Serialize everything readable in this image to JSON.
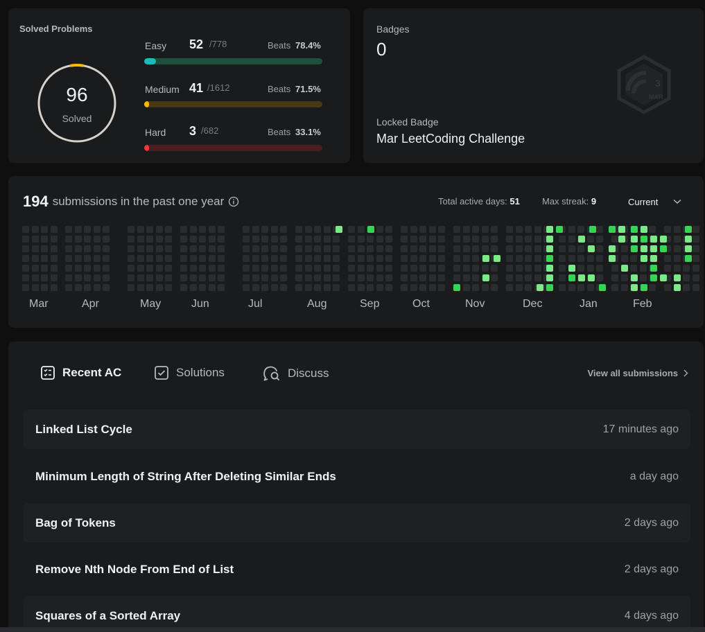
{
  "solved": {
    "title": "Solved Problems",
    "total": "96",
    "total_label": "Solved",
    "easy": {
      "label": "Easy",
      "count": "52",
      "total": "/778",
      "beats_label": "Beats",
      "beats": "78.4%",
      "fraction": 0.067,
      "color": "#1cbaba",
      "track": "#1d4f3b"
    },
    "medium": {
      "label": "Medium",
      "count": "41",
      "total": "/1612",
      "beats_label": "Beats",
      "beats": "71.5%",
      "fraction": 0.025,
      "color": "#ffb700",
      "track": "#463a14"
    },
    "hard": {
      "label": "Hard",
      "count": "3",
      "total": "/682",
      "beats_label": "Beats",
      "beats": "33.1%",
      "fraction": 0.004,
      "color": "#f63737",
      "track": "#4a1e1e"
    }
  },
  "badges": {
    "title": "Badges",
    "count": "0",
    "locked_label": "Locked Badge",
    "locked_name": "Mar LeetCoding Challenge",
    "icon_text": "MAR",
    "icon_num": "3"
  },
  "calendar": {
    "count": "194",
    "text": "submissions in the past one year",
    "active_label": "Total active days:",
    "active_value": "51",
    "streak_label": "Max streak:",
    "streak_value": "9",
    "selector": "Current",
    "months": [
      "Mar",
      "Apr",
      "May",
      "Jun",
      "Jul",
      "Aug",
      "Sep",
      "Oct",
      "Nov",
      "Dec",
      "Jan",
      "Feb"
    ],
    "colors": {
      "empty": "#2b2c2f",
      "l1": "#26a641",
      "l2": "#39d353",
      "l3": "#7ee787"
    }
  },
  "recent": {
    "tabs": [
      {
        "label": "Recent AC",
        "icon": "list-icon"
      },
      {
        "label": "Solutions",
        "icon": "check-square-icon"
      },
      {
        "label": "Discuss",
        "icon": "discuss-icon"
      }
    ],
    "view_all": "View all submissions",
    "items": [
      {
        "title": "Linked List Cycle",
        "time": "17 minutes ago"
      },
      {
        "title": "Minimum Length of String After Deleting Similar Ends",
        "time": "a day ago"
      },
      {
        "title": "Bag of Tokens",
        "time": "2 days ago"
      },
      {
        "title": "Remove Nth Node From End of List",
        "time": "2 days ago"
      },
      {
        "title": "Squares of a Sorted Array",
        "time": "4 days ago"
      }
    ]
  }
}
